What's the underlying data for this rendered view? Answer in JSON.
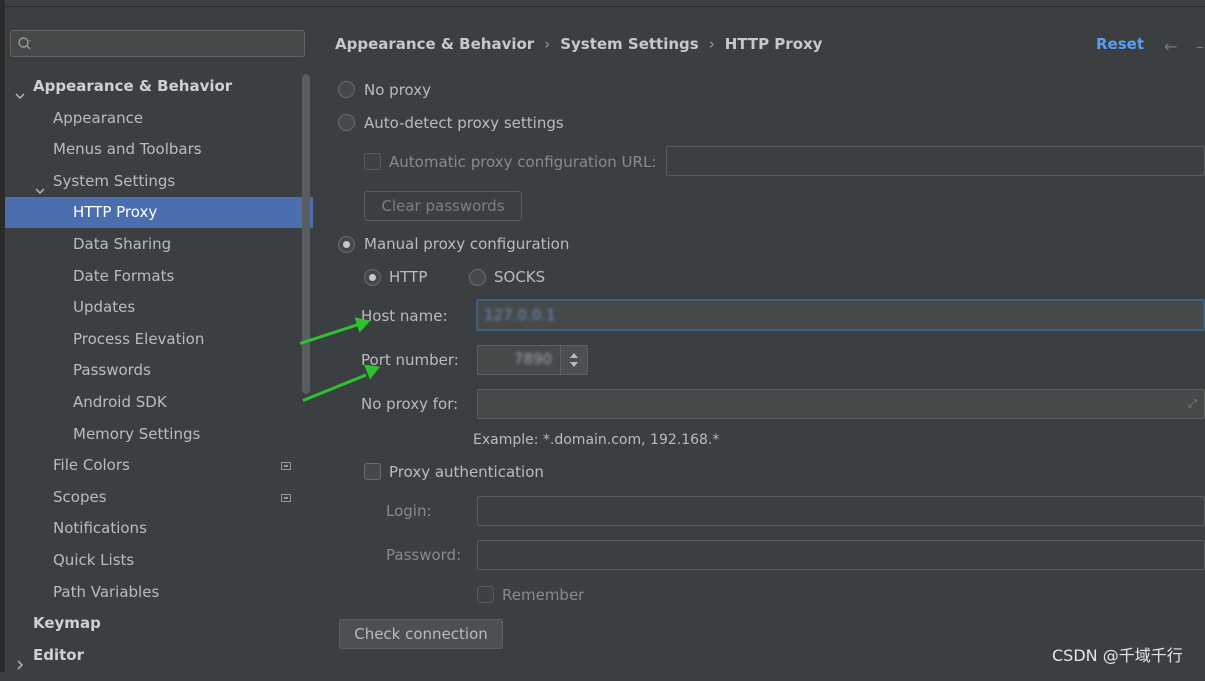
{
  "sidebar": {
    "search": {
      "value": "",
      "placeholder": ""
    },
    "items": [
      {
        "label": "Appearance & Behavior",
        "level": 0,
        "expanded": true,
        "bold": true
      },
      {
        "label": "Appearance",
        "level": 1
      },
      {
        "label": "Menus and Toolbars",
        "level": 1
      },
      {
        "label": "System Settings",
        "level": 1,
        "expanded": true
      },
      {
        "label": "HTTP Proxy",
        "level": 2,
        "selected": true
      },
      {
        "label": "Data Sharing",
        "level": 2
      },
      {
        "label": "Date Formats",
        "level": 2
      },
      {
        "label": "Updates",
        "level": 2
      },
      {
        "label": "Process Elevation",
        "level": 2
      },
      {
        "label": "Passwords",
        "level": 2
      },
      {
        "label": "Android SDK",
        "level": 2
      },
      {
        "label": "Memory Settings",
        "level": 2
      },
      {
        "label": "File Colors",
        "level": 1,
        "badge": true
      },
      {
        "label": "Scopes",
        "level": 1,
        "badge": true
      },
      {
        "label": "Notifications",
        "level": 1
      },
      {
        "label": "Quick Lists",
        "level": 1
      },
      {
        "label": "Path Variables",
        "level": 1
      },
      {
        "label": "Keymap",
        "level": 0,
        "bold": true
      },
      {
        "label": "Editor",
        "level": 0,
        "bold": true,
        "expanded": false
      }
    ]
  },
  "header": {
    "breadcrumb": [
      "Appearance & Behavior",
      "System Settings",
      "HTTP Proxy"
    ],
    "reset_label": "Reset"
  },
  "proxy": {
    "no_proxy_label": "No proxy",
    "auto_detect_label": "Auto-detect proxy settings",
    "auto_config_url_label": "Automatic proxy configuration URL:",
    "clear_passwords_label": "Clear passwords",
    "manual_label": "Manual proxy configuration",
    "http_label": "HTTP",
    "socks_label": "SOCKS",
    "host_label": "Host name:",
    "host_value": "127.0.0.1",
    "port_label": "Port number:",
    "port_value": "7890",
    "no_proxy_for_label": "No proxy for:",
    "example_text": "Example: *.domain.com, 192.168.*",
    "proxy_auth_label": "Proxy authentication",
    "login_label": "Login:",
    "password_label": "Password:",
    "remember_label": "Remember",
    "check_connection_label": "Check connection",
    "selected_mode": "manual",
    "selected_type": "http"
  },
  "watermark": "CSDN @千域千行",
  "colors": {
    "selection": "#4b6eaf",
    "link": "#589df6",
    "annotation_arrow": "#2fc22f",
    "background": "#3c3f41"
  }
}
